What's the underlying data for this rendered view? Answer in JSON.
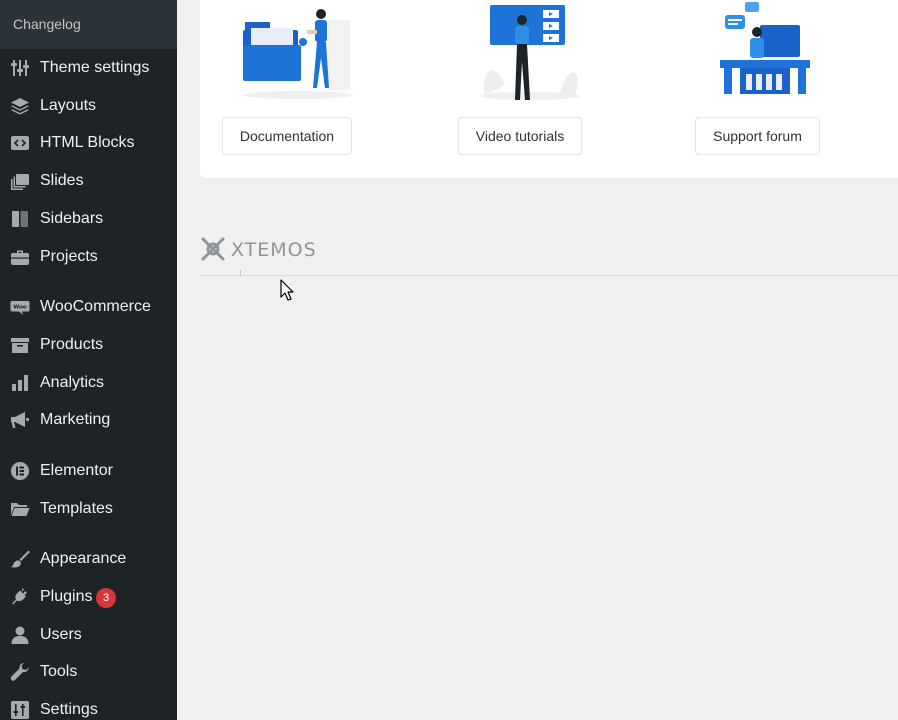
{
  "sidebar": {
    "top_label": "Changelog",
    "items": [
      {
        "label": "Theme settings",
        "icon": "sliders-icon"
      },
      {
        "label": "Layouts",
        "icon": "layers-icon"
      },
      {
        "label": "HTML Blocks",
        "icon": "code-icon"
      },
      {
        "label": "Slides",
        "icon": "slides-icon"
      },
      {
        "label": "Sidebars",
        "icon": "sidebar-icon"
      },
      {
        "label": "Projects",
        "icon": "briefcase-icon"
      },
      {
        "label": "WooCommerce",
        "icon": "woo-icon"
      },
      {
        "label": "Products",
        "icon": "archive-icon"
      },
      {
        "label": "Analytics",
        "icon": "bar-chart-icon"
      },
      {
        "label": "Marketing",
        "icon": "megaphone-icon"
      },
      {
        "label": "Elementor",
        "icon": "elementor-icon"
      },
      {
        "label": "Templates",
        "icon": "folder-icon"
      },
      {
        "label": "Appearance",
        "icon": "paintbrush-icon"
      },
      {
        "label": "Plugins",
        "icon": "plug-icon",
        "badge": "3"
      },
      {
        "label": "Users",
        "icon": "user-icon"
      },
      {
        "label": "Tools",
        "icon": "wrench-icon"
      },
      {
        "label": "Settings",
        "icon": "settings-icon"
      }
    ]
  },
  "resources": {
    "documentation": "Documentation",
    "video_tutorials": "Video tutorials",
    "support_forum": "Support forum"
  },
  "logo": {
    "text": "XTEMOS"
  },
  "colors": {
    "sidebar_bg": "#1d2327",
    "accent_blue": "#1e73d8",
    "badge_red": "#d63638",
    "accent_orange": "#e35a1c"
  }
}
